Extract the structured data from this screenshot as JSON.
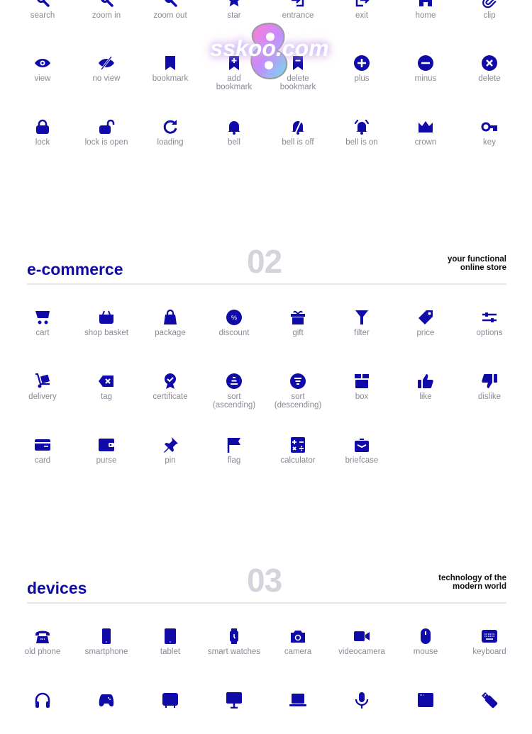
{
  "theme": {
    "accent": "#0f0aa8",
    "label_color": "#8a8a96",
    "number_color": "#d4d4dc"
  },
  "watermark": "sskoo.com",
  "section1": {
    "rows": [
      [
        {
          "label": "search",
          "icon": "search-icon"
        },
        {
          "label": "zoom in",
          "icon": "zoom-in-icon"
        },
        {
          "label": "zoom out",
          "icon": "zoom-out-icon"
        },
        {
          "label": "star",
          "icon": "star-icon"
        },
        {
          "label": "entrance",
          "icon": "entrance-icon"
        },
        {
          "label": "exit",
          "icon": "exit-icon"
        },
        {
          "label": "home",
          "icon": "home-icon"
        },
        {
          "label": "clip",
          "icon": "clip-icon"
        }
      ],
      [
        {
          "label": "view",
          "icon": "eye-icon"
        },
        {
          "label": "no view",
          "icon": "eye-off-icon"
        },
        {
          "label": "bookmark",
          "icon": "bookmark-icon"
        },
        {
          "label": "add\nbookmark",
          "icon": "bookmark-add-icon"
        },
        {
          "label": "delete\nbookmark",
          "icon": "bookmark-remove-icon"
        },
        {
          "label": "plus",
          "icon": "plus-circle-icon"
        },
        {
          "label": "minus",
          "icon": "minus-circle-icon"
        },
        {
          "label": "delete",
          "icon": "close-circle-icon"
        }
      ],
      [
        {
          "label": "lock",
          "icon": "lock-icon"
        },
        {
          "label": "lock is open",
          "icon": "unlock-icon"
        },
        {
          "label": "loading",
          "icon": "reload-icon"
        },
        {
          "label": "bell",
          "icon": "bell-icon"
        },
        {
          "label": "bell is off",
          "icon": "bell-off-icon"
        },
        {
          "label": "bell is on",
          "icon": "bell-ring-icon"
        },
        {
          "label": "crown",
          "icon": "crown-icon"
        },
        {
          "label": "key",
          "icon": "key-icon"
        }
      ]
    ]
  },
  "section2": {
    "title": "e-commerce",
    "number": "02",
    "subtitle_line1": "your functional",
    "subtitle_line2": "online store",
    "rows": [
      [
        {
          "label": "cart",
          "icon": "cart-icon"
        },
        {
          "label": "shop basket",
          "icon": "basket-icon"
        },
        {
          "label": "package",
          "icon": "shopping-bag-icon"
        },
        {
          "label": "discount",
          "icon": "discount-icon"
        },
        {
          "label": "gift",
          "icon": "gift-icon"
        },
        {
          "label": "filter",
          "icon": "filter-icon"
        },
        {
          "label": "price",
          "icon": "price-tag-icon"
        },
        {
          "label": "options",
          "icon": "sliders-icon"
        }
      ],
      [
        {
          "label": "delivery",
          "icon": "hand-truck-icon"
        },
        {
          "label": "tag",
          "icon": "tag-x-icon"
        },
        {
          "label": "certificate",
          "icon": "certificate-icon"
        },
        {
          "label": "sort\n(ascending)",
          "icon": "sort-ascending-icon"
        },
        {
          "label": "sort\n(descending)",
          "icon": "sort-descending-icon"
        },
        {
          "label": "box",
          "icon": "box-icon"
        },
        {
          "label": "like",
          "icon": "thumbs-up-icon"
        },
        {
          "label": "dislike",
          "icon": "thumbs-down-icon"
        }
      ],
      [
        {
          "label": "card",
          "icon": "credit-card-icon"
        },
        {
          "label": "purse",
          "icon": "wallet-icon"
        },
        {
          "label": "pin",
          "icon": "pushpin-icon"
        },
        {
          "label": "flag",
          "icon": "flag-icon"
        },
        {
          "label": "calculator",
          "icon": "calculator-icon"
        },
        {
          "label": "briefcase",
          "icon": "briefcase-icon"
        }
      ]
    ]
  },
  "section3": {
    "title": "devices",
    "number": "03",
    "subtitle_line1": "technology of the",
    "subtitle_line2": "modern world",
    "rows": [
      [
        {
          "label": "old phone",
          "icon": "old-phone-icon"
        },
        {
          "label": "smartphone",
          "icon": "smartphone-icon"
        },
        {
          "label": "tablet",
          "icon": "tablet-icon"
        },
        {
          "label": "smart watches",
          "icon": "smartwatch-icon"
        },
        {
          "label": "camera",
          "icon": "camera-icon"
        },
        {
          "label": "videocamera",
          "icon": "videocamera-icon"
        },
        {
          "label": "mouse",
          "icon": "mouse-icon"
        },
        {
          "label": "keyboard",
          "icon": "keyboard-icon"
        }
      ],
      [
        {
          "label": "",
          "icon": "headphones-icon"
        },
        {
          "label": "",
          "icon": "gamepad-icon"
        },
        {
          "label": "",
          "icon": "tv-icon"
        },
        {
          "label": "",
          "icon": "monitor-icon"
        },
        {
          "label": "",
          "icon": "laptop-icon"
        },
        {
          "label": "",
          "icon": "microphone-icon"
        },
        {
          "label": "",
          "icon": "app-window-icon"
        },
        {
          "label": "",
          "icon": "usb-drive-icon"
        }
      ]
    ]
  }
}
